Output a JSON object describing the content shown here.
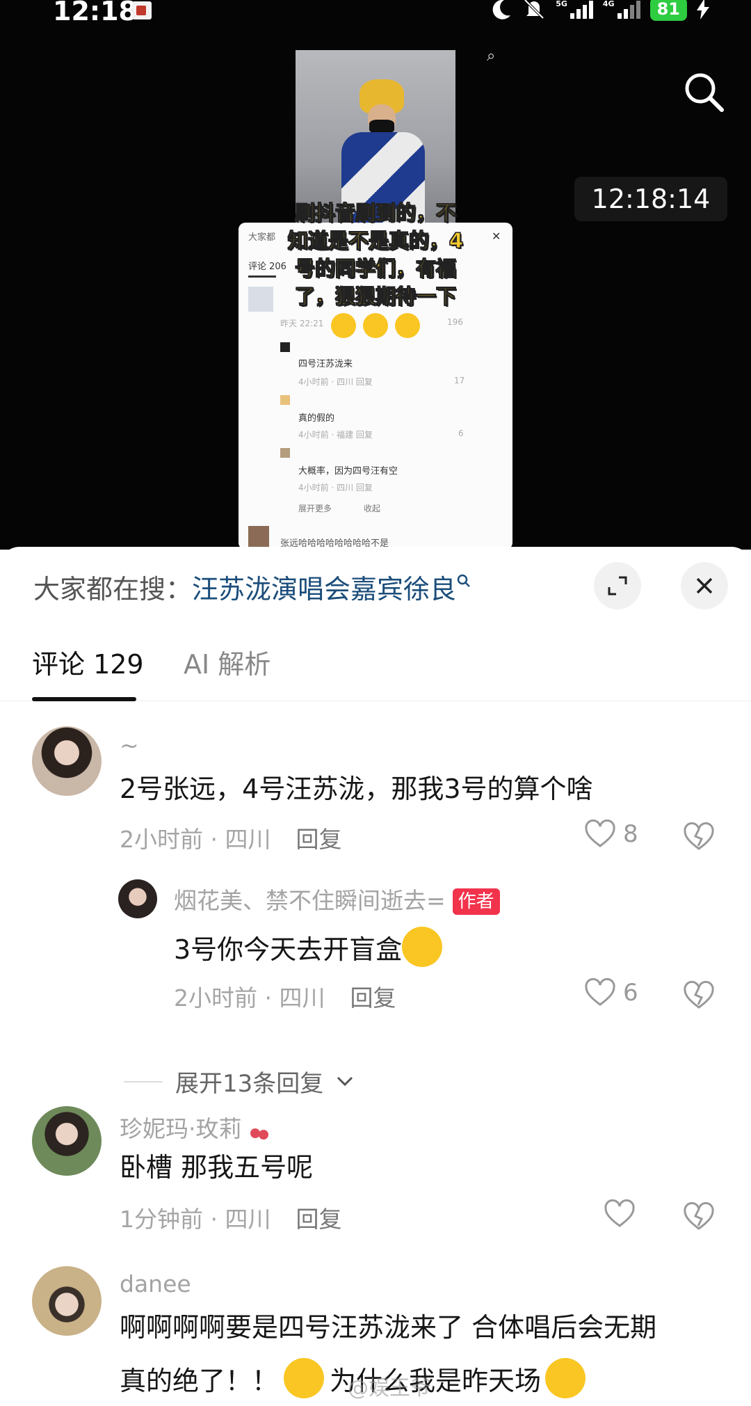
{
  "status_bar": {
    "time": "12:18",
    "signal1": "5G",
    "signal2": "4G",
    "battery": "81"
  },
  "video": {
    "timestamp": "12:18:14",
    "overlay_lines": [
      "刷抖音刷到的，不",
      "知道是不是真的，4",
      "号的同学们，有福",
      "了，狠狠期待一下"
    ],
    "mini": {
      "header": "大家都",
      "tab": "评论 206",
      "time1": "昨天 22:21",
      "like1": "196",
      "c1": "四号汪苏泷来",
      "meta1": "4小时前 · 四川  回复",
      "like2": "17",
      "c2": "真的假的",
      "meta2": "4小时前 · 福建  回复",
      "like3": "6",
      "c3": "大概率，因为四号汪有空",
      "meta3": "4小时前 · 四川  回复",
      "more": "展开更多",
      "collapse": "收起",
      "last": "张远哈哈哈哈哈哈哈哈不是"
    }
  },
  "sheet": {
    "search_label": "大家都在搜：",
    "search_keyword": "汪苏泷演唱会嘉宾徐良",
    "tabs": {
      "comments": "评论 129",
      "ai": "AI 解析"
    }
  },
  "comments": [
    {
      "username": "~",
      "text": "2号张远，4号汪苏泷，那我3号的算个啥",
      "time": "2小时前 · 四川",
      "reply": "回复",
      "likes": "8"
    },
    {
      "username": "烟花美、禁不住瞬间逝去=",
      "badge": "作者",
      "text": "3号你今天去开盲盒",
      "time": "2小时前 · 四川",
      "reply": "回复",
      "likes": "6"
    },
    {
      "username": "珍妮玛·玫莉",
      "text": "卧槽 那我五号呢",
      "time": "1分钟前 · 四川",
      "reply": "回复",
      "likes": ""
    },
    {
      "username": "danee",
      "text_line1": "啊啊啊啊要是四号汪苏泷来了 合体唱后会无期",
      "text_line2a": "真的绝了！！",
      "text_line2b": "为什么我是昨天场"
    }
  ],
  "expand_replies": "展开13条回复",
  "watermark": "@娱王爷"
}
